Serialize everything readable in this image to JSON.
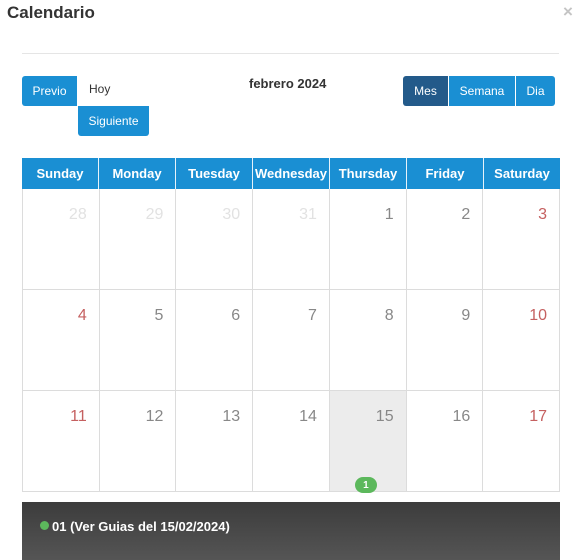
{
  "modal": {
    "title": "Calendario",
    "close_glyph": "×"
  },
  "toolbar": {
    "prev_label": "Previo",
    "today_label": "Hoy",
    "next_label": "Siguiente",
    "period_title": "febrero 2024",
    "view_month_label": "Mes",
    "view_week_label": "Semana",
    "view_day_label": "Dia"
  },
  "calendar": {
    "weekdays": [
      "Sunday",
      "Monday",
      "Tuesday",
      "Wednesday",
      "Thursday",
      "Friday",
      "Saturday"
    ],
    "weeks": [
      [
        {
          "day": "28",
          "state": "other"
        },
        {
          "day": "29",
          "state": "other"
        },
        {
          "day": "30",
          "state": "other"
        },
        {
          "day": "31",
          "state": "other"
        },
        {
          "day": "1",
          "state": ""
        },
        {
          "day": "2",
          "state": ""
        },
        {
          "day": "3",
          "state": "weekend"
        }
      ],
      [
        {
          "day": "4",
          "state": "weekend"
        },
        {
          "day": "5",
          "state": ""
        },
        {
          "day": "6",
          "state": ""
        },
        {
          "day": "7",
          "state": ""
        },
        {
          "day": "8",
          "state": ""
        },
        {
          "day": "9",
          "state": ""
        },
        {
          "day": "10",
          "state": "weekend"
        }
      ],
      [
        {
          "day": "11",
          "state": "weekend"
        },
        {
          "day": "12",
          "state": ""
        },
        {
          "day": "13",
          "state": ""
        },
        {
          "day": "14",
          "state": ""
        },
        {
          "day": "15",
          "state": "today",
          "badge": "1"
        },
        {
          "day": "16",
          "state": ""
        },
        {
          "day": "17",
          "state": "weekend"
        }
      ]
    ]
  },
  "event_tooltip": {
    "text": "01 (Ver Guias del 15/02/2024)"
  },
  "colors": {
    "primary": "#1a8fd3",
    "active_view": "#235a8a",
    "event_dot": "#5cb85c",
    "weekend_text": "#c56060"
  }
}
